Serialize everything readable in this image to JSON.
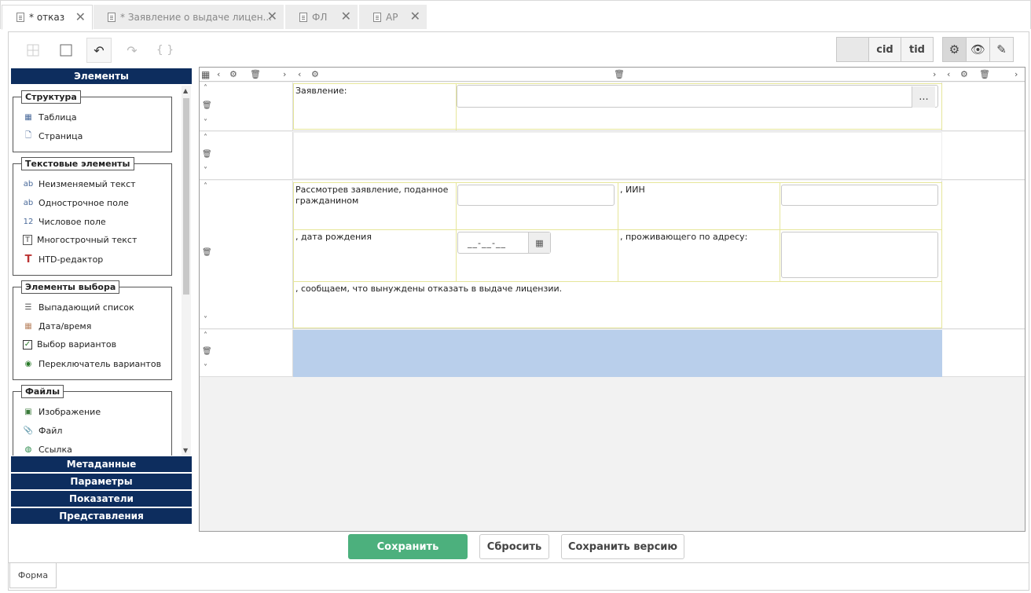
{
  "tabs": [
    {
      "label": "* отказ",
      "active": true
    },
    {
      "label": "* Заявление о выдаче лицен...",
      "active": false
    },
    {
      "label": "ФЛ",
      "active": false
    },
    {
      "label": "АР",
      "active": false
    }
  ],
  "toolbar": {
    "cid_label": "cid",
    "tid_label": "tid",
    "braces_label": "{ }"
  },
  "left_panel": {
    "elements_header": "Элементы",
    "groups": [
      {
        "title": "Структура",
        "items": [
          {
            "label": "Таблица",
            "icon": "table-add-icon"
          },
          {
            "label": "Страница",
            "icon": "page-add-icon"
          }
        ]
      },
      {
        "title": "Текстовые элементы",
        "items": [
          {
            "label": "Неизменяемый текст",
            "icon": "static-text-icon"
          },
          {
            "label": "Однострочное поле",
            "icon": "single-line-icon"
          },
          {
            "label": "Числовое поле",
            "icon": "number-field-icon"
          },
          {
            "label": "Многострочный текст",
            "icon": "multiline-text-icon"
          },
          {
            "label": "HTD-редактор",
            "icon": "htd-editor-icon"
          }
        ]
      },
      {
        "title": "Элементы выбора",
        "items": [
          {
            "label": "Выпадающий список",
            "icon": "dropdown-list-icon"
          },
          {
            "label": "Дата/время",
            "icon": "calendar-icon"
          },
          {
            "label": "Выбор вариантов",
            "icon": "checkbox-icon"
          },
          {
            "label": "Переключатель вариантов",
            "icon": "radio-icon"
          }
        ]
      },
      {
        "title": "Файлы",
        "items": [
          {
            "label": "Изображение",
            "icon": "image-icon"
          },
          {
            "label": "Файл",
            "icon": "paperclip-icon"
          },
          {
            "label": "Ссылка",
            "icon": "link-icon"
          }
        ]
      }
    ],
    "accordion": [
      "Метаданные",
      "Параметры",
      "Показатели",
      "Представления"
    ]
  },
  "form": {
    "statement_label": "Заявление:",
    "statement_button": "...",
    "considered_label": "Рассмотрев заявление, поданное гражданином",
    "iin_label": ", ИИН",
    "birthdate_label": ", дата рождения",
    "date_placeholder": "__-__-__",
    "address_label": ", проживающего по адресу:",
    "refusal_text": ", сообщаем, что вынуждены отказать в выдаче лицензии."
  },
  "buttons": {
    "save": "Сохранить",
    "reset": "Сбросить",
    "save_version": "Сохранить версию"
  },
  "bottom_tab": "Форма",
  "colors": {
    "header_navy": "#0d2d5e",
    "save_green": "#4cb07d",
    "selected_row": "#b9cfeb",
    "cell_border": "#e6e69a"
  }
}
